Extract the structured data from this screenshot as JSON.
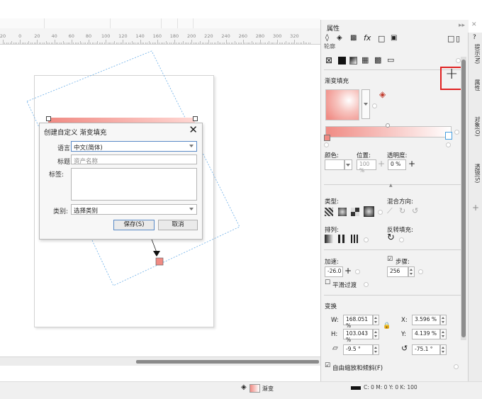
{
  "ruler": {
    "labels": [
      "20",
      "0",
      "20",
      "40",
      "60",
      "80",
      "100",
      "120",
      "140",
      "160",
      "180",
      "200",
      "220",
      "240",
      "260",
      "280",
      "300",
      "320"
    ]
  },
  "dialog": {
    "title": "创建自定义 渐变填充",
    "language_label": "语言:",
    "language_value": "中文(简体)",
    "title_label": "标题:",
    "title_placeholder": "资产名称",
    "tags_label": "标签:",
    "category_label": "类别:",
    "category_value": "选择类别",
    "save_button": "保存(S)",
    "cancel_button": "取消"
  },
  "panel": {
    "title": "属性",
    "header_cut": "轮廓",
    "gradient_fill": "渐变填充",
    "color_label": "颜色:",
    "position_label": "位置:",
    "position_value": "100 %",
    "transparency_label": "透明度:",
    "transparency_value": "0 %",
    "type_label": "类型:",
    "blend_label": "混合方向:",
    "arrange_label": "排列:",
    "reverse_label": "反转填充:",
    "accel_label": "加速:",
    "accel_value": "-26.0",
    "steps_label": "步骤:",
    "steps_value": "256",
    "smooth_label": "平滑过渡",
    "transform_label": "变换",
    "w_label": "W:",
    "w_value": "168.051 %",
    "h_label": "H:",
    "h_value": "103.043 %",
    "x_label": "X:",
    "x_value": "3.596 %",
    "y_label": "Y:",
    "y_value": "4.139 %",
    "skew_value": "-9.5 °",
    "rotate_value": "-75.1 °",
    "free_scale_label": "自由缩放和倾斜(F)",
    "add_plus": "+"
  },
  "side_tabs": {
    "hints": "提示(N)",
    "props": "属性",
    "objects": "对象(O)",
    "transparency": "透镜(S)",
    "plus": "+"
  },
  "status": {
    "fill_label": "渐变",
    "color_readout": "C: 0 M: 0 Y: 0 K: 100"
  },
  "colors": {
    "gradient_start": "#f08b84",
    "gradient_end": "#ffffff",
    "highlight_red": "#e02020",
    "selection_blue": "#4aa0e0"
  }
}
